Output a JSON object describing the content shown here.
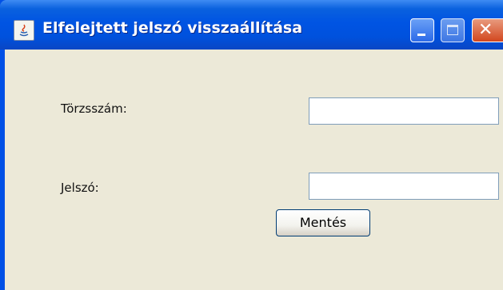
{
  "window": {
    "title": "Elfelejtett jelszó visszaállítása",
    "controls": {
      "minimize": "minimize",
      "maximize": "maximize",
      "close": "✕"
    }
  },
  "form": {
    "id_label": "Törzsszám:",
    "id_value": "",
    "password_label": "Jelszó:",
    "password_value": "",
    "save_label": "Mentés"
  },
  "colors": {
    "titlebar": "#0054e3",
    "window_bg": "#ece9d8",
    "close_button": "#d2461e"
  }
}
